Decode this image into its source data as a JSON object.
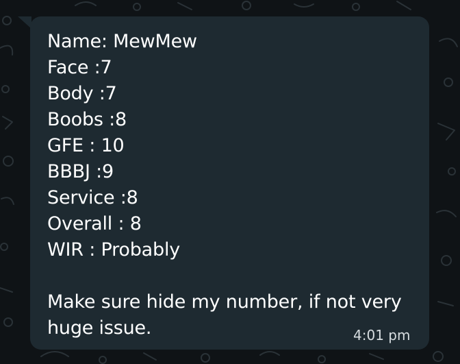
{
  "message": {
    "lines": [
      "Name: MewMew",
      "Face :7",
      "Body :7",
      "Boobs :8",
      "GFE : 10",
      "BBBJ :9",
      "Service :8",
      "Overall : 8",
      "WIR : Probably"
    ],
    "paragraph": "Make sure hide my number, if not very huge issue.",
    "time": "4:01 pm"
  },
  "colors": {
    "background": "#0f1316",
    "bubble": "#1e2a31",
    "text": "#ffffff",
    "time": "#d7dde0"
  }
}
